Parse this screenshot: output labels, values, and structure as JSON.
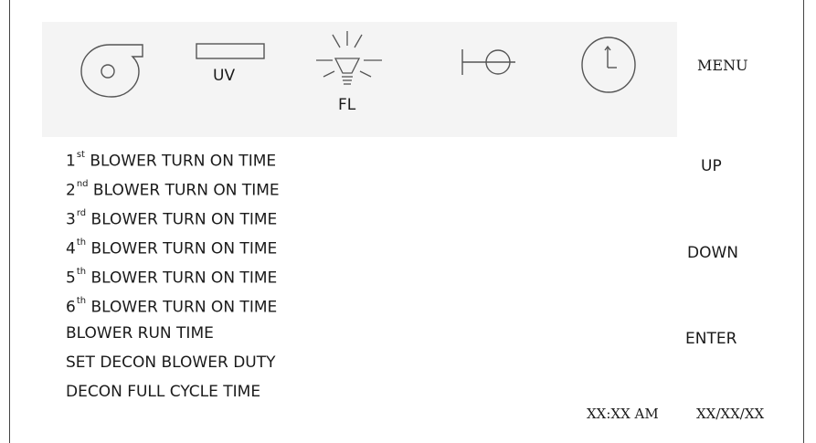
{
  "toolbar": {
    "uv_label": "UV",
    "fl_label": "FL",
    "menu_label": "MENU"
  },
  "menu_items": [
    {
      "num": "1",
      "sup": "st",
      "text": "BLOWER TURN ON TIME"
    },
    {
      "num": "2",
      "sup": "nd",
      "text": "BLOWER TURN ON TIME"
    },
    {
      "num": "3",
      "sup": "rd",
      "text": "BLOWER TURN ON TIME"
    },
    {
      "num": "4",
      "sup": "th",
      "text": "BLOWER TURN ON TIME"
    },
    {
      "num": "5",
      "sup": "th",
      "text": "BLOWER TURN ON TIME"
    },
    {
      "num": "6",
      "sup": "th",
      "text": "BLOWER TURN ON TIME"
    },
    {
      "num": "",
      "sup": "",
      "text": "BLOWER RUN TIME"
    },
    {
      "num": "",
      "sup": "",
      "text": "SET DECON BLOWER DUTY"
    },
    {
      "num": "",
      "sup": "",
      "text": "DECON FULL CYCLE TIME"
    }
  ],
  "nav": {
    "up_label": "UP",
    "down_label": "DOWN",
    "enter_label": "ENTER"
  },
  "status": {
    "time": "XX:XX AM",
    "date": "XX/XX/XX"
  }
}
